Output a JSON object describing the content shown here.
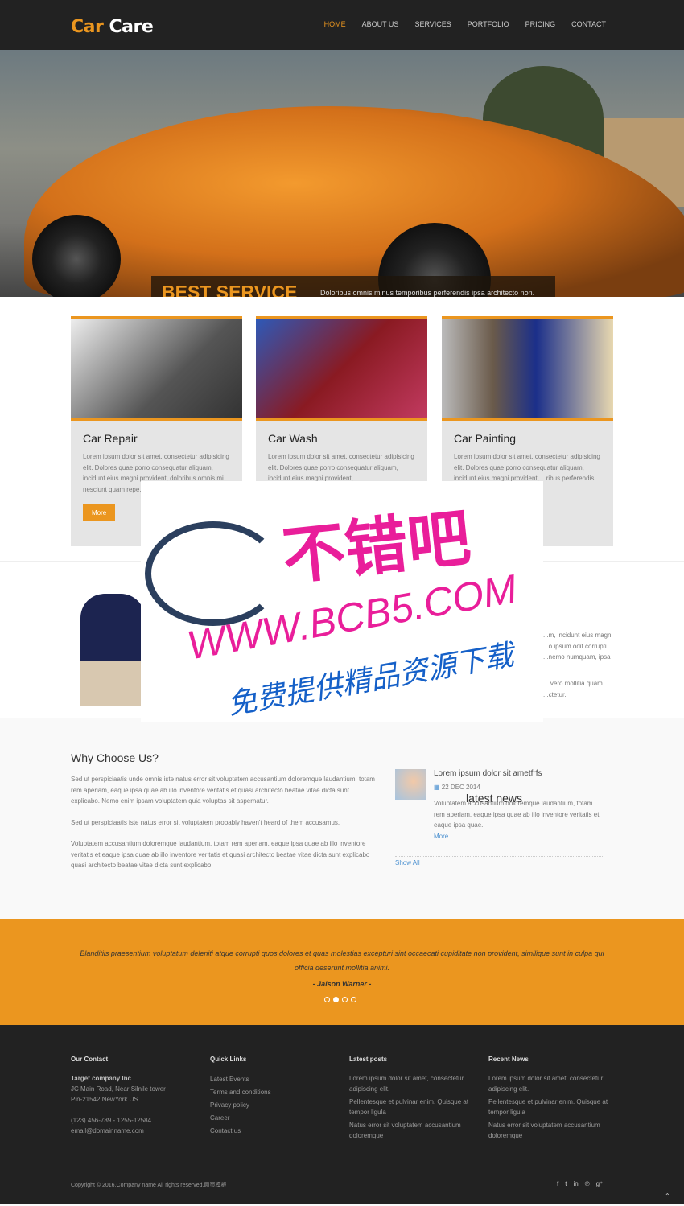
{
  "header": {
    "logo_a": "Car",
    "logo_b": "Care",
    "nav": [
      "HOME",
      "ABOUT US",
      "SERVICES",
      "PORTFOLIO",
      "PRICING",
      "CONTACT"
    ]
  },
  "hero": {
    "title": "BEST SERVICE",
    "text": "Doloribus omnis minus temporibus perferendis ipsa architecto non."
  },
  "services": [
    {
      "title": "Car Repair",
      "text": "Lorem ipsum dolor sit amet, consectetur adipisicing elit. Dolores quae porro consequatur aliquam, incidunt eius magni provident, doloribus omnis mi... nesciunt quam repe... odit corrupti consec...",
      "more": "More"
    },
    {
      "title": "Car Wash",
      "text": "Lorem ipsum dolor sit amet, consectetur adipisicing elit. Dolores quae porro consequatur aliquam, incidunt eius magni provident,"
    },
    {
      "title": "Car Painting",
      "text": "Lorem ipsum dolor sit amet, consectetur adipisicing elit. Dolores quae porro consequatur aliquam, incidunt eius magni provident, ...ribus perferendis ...ulla nemo ipsum ...ssimus"
    }
  ],
  "team": {
    "text1": "...m, incidunt eius magni ...o ipsum odit corrupti ...nemo numquam, ipsa",
    "text2": "... vero mollitia quam ...ctetur."
  },
  "why": {
    "title": "Why Choose Us?",
    "p1": "Sed ut perspiciaatis unde omnis iste natus error sit voluptatem accusantium doloremque laudantium, totam rem aperiam, eaque ipsa quae ab illo inventore veritatis et quasi architecto beatae vitae dicta sunt explicabo. Nemo enim ipsam voluptatem quia voluptas sit aspernatur.",
    "p2": "Sed ut perspiciaatis iste natus error sit voluptatem probably haven't heard of them accusamus.",
    "p3": "Voluptatem accusantium doloremque laudantium, totam rem aperiam, eaque ipsa quae ab illo inventore veritatis et eaque ipsa quae ab illo inventore veritatis et quasi architecto beatae vitae dicta sunt explicabo quasi architecto beatae vitae dicta sunt explicabo."
  },
  "news": {
    "title": "latest news",
    "item_title": "Lorem ipsum dolor sit ametfrfs",
    "date": "22 DEC 2014",
    "text": "Voluptatem accusantium doloremque laudantium, totam rem aperiam, eaque ipsa quae ab illo inventore veritatis et eaque ipsa quae.",
    "more": "More...",
    "show_all": "Show All"
  },
  "testimonial": {
    "quote": "Blanditiis praesentium voluptatum deleniti atque corrupti quos dolores et quas molestias excepturi sint occaecati cupiditate non provident, similique sunt in culpa qui officia deserunt mollitia animi.",
    "author": "- Jaison Warner -",
    "active_dot": 2,
    "dots": 4
  },
  "footer": {
    "contact": {
      "title": "Our Contact",
      "company": "Target company Inc",
      "addr1": "JC Main Road, Near Silnile tower",
      "addr2": "Pin-21542 NewYork US.",
      "phone": "(123) 456-789 - 1255-12584",
      "email": "email@domainname.com"
    },
    "links": {
      "title": "Quick Links",
      "items": [
        "Latest Events",
        "Terms and conditions",
        "Privacy policy",
        "Career",
        "Contact us"
      ]
    },
    "posts": {
      "title": "Latest posts",
      "items": [
        "Lorem ipsum dolor sit amet, consectetur adipiscing elit.",
        "Pellentesque et pulvinar enim. Quisque at tempor ligula",
        "Natus error sit voluptatem accusantium doloremque"
      ]
    },
    "recent": {
      "title": "Recent News",
      "items": [
        "Lorem ipsum dolor sit amet, consectetur adipiscing elit.",
        "Pellentesque et pulvinar enim. Quisque at tempor ligula",
        "Natus error sit voluptatem accusantium doloremque"
      ]
    },
    "copyright": "Copyright © 2016.Company name All rights reserved.网页模板",
    "social": [
      "facebook-icon",
      "twitter-icon",
      "linkedin-icon",
      "pinterest-icon",
      "google-plus-icon"
    ]
  },
  "watermark": {
    "line1": "不错吧",
    "line2": "WWW.BCB5.COM",
    "line3": "免费提供精品资源下载"
  },
  "colors": {
    "accent": "#eb961f",
    "dark": "#222222"
  }
}
